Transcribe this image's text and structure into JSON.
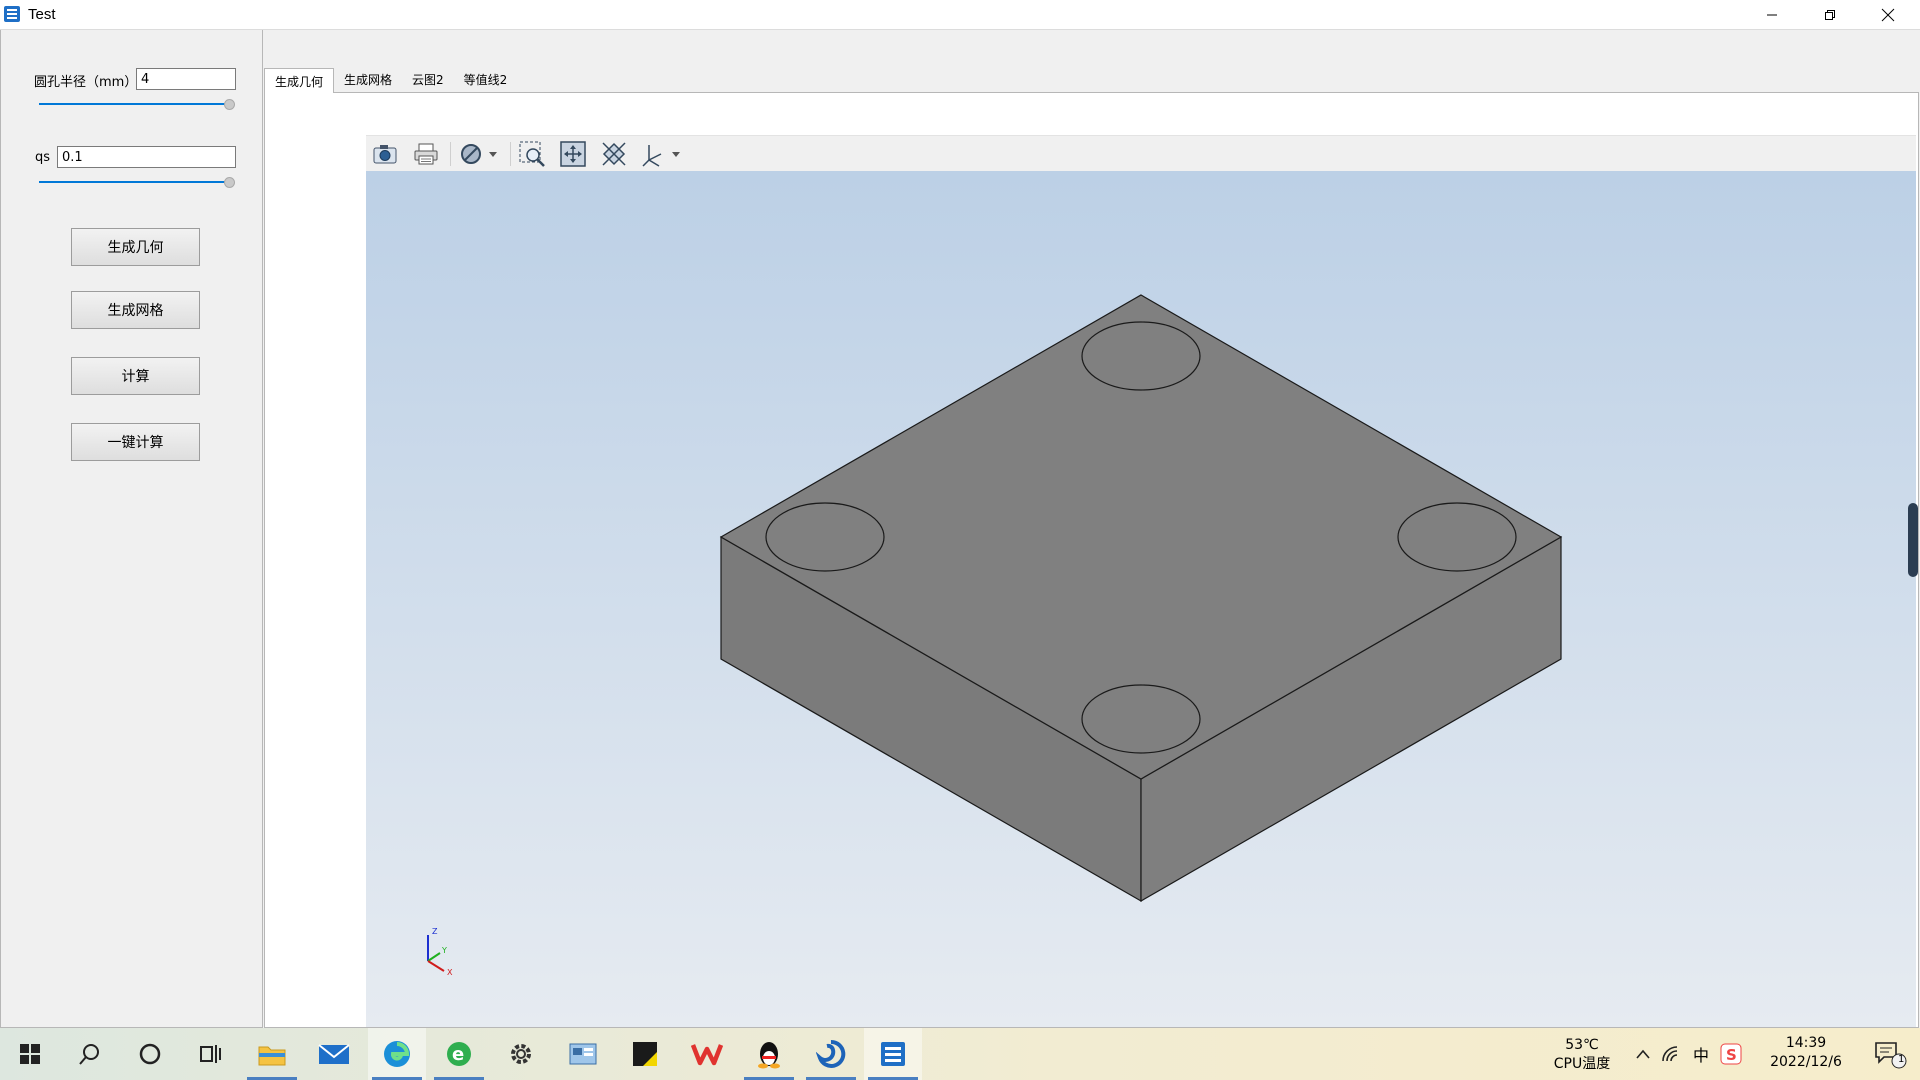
{
  "window": {
    "title": "Test",
    "accent": "#0078d7"
  },
  "left_panel": {
    "radius_label": "圆孔半径（mm）",
    "radius_value": "4",
    "radius_slider_level": 1.0,
    "qs_label": "qs",
    "qs_value": "0.1",
    "qs_slider_level": 1.0,
    "buttons": {
      "generate_geometry": "生成几何",
      "generate_mesh": "生成网格",
      "compute": "计算",
      "one_click_compute": "一键计算"
    }
  },
  "tabs": [
    {
      "label": "生成几何",
      "active": true
    },
    {
      "label": "生成网格",
      "active": false
    },
    {
      "label": "云图2",
      "active": false
    },
    {
      "label": "等值线2",
      "active": false
    }
  ],
  "viewer": {
    "toolbar_icons": [
      "camera-icon",
      "print-icon",
      "display-style-icon",
      "zoom-area-icon",
      "fit-all-icon",
      "fit-selection-icon",
      "axis-view-icon"
    ],
    "model_color": "#808080",
    "background_top": "#bcd0e6",
    "background_bottom": "#e6ebf1",
    "axis_labels": {
      "z": "Z",
      "y": "Y",
      "x": "X"
    }
  },
  "taskbar": {
    "icons": [
      "windows-start-icon",
      "search-icon",
      "cortana-icon",
      "task-view-icon",
      "file-explorer-icon",
      "mail-icon",
      "edge-icon",
      "ie-icon",
      "settings-icon",
      "control-panel-icon",
      "sticky-notes-icon",
      "wps-icon",
      "qq-icon",
      "app-swirl-icon",
      "test-app-icon"
    ],
    "cpu_temp": "53℃",
    "cpu_label": "CPU温度",
    "time": "14:39",
    "date": "2022/12/6",
    "ime": "中",
    "notification_count": "1"
  }
}
